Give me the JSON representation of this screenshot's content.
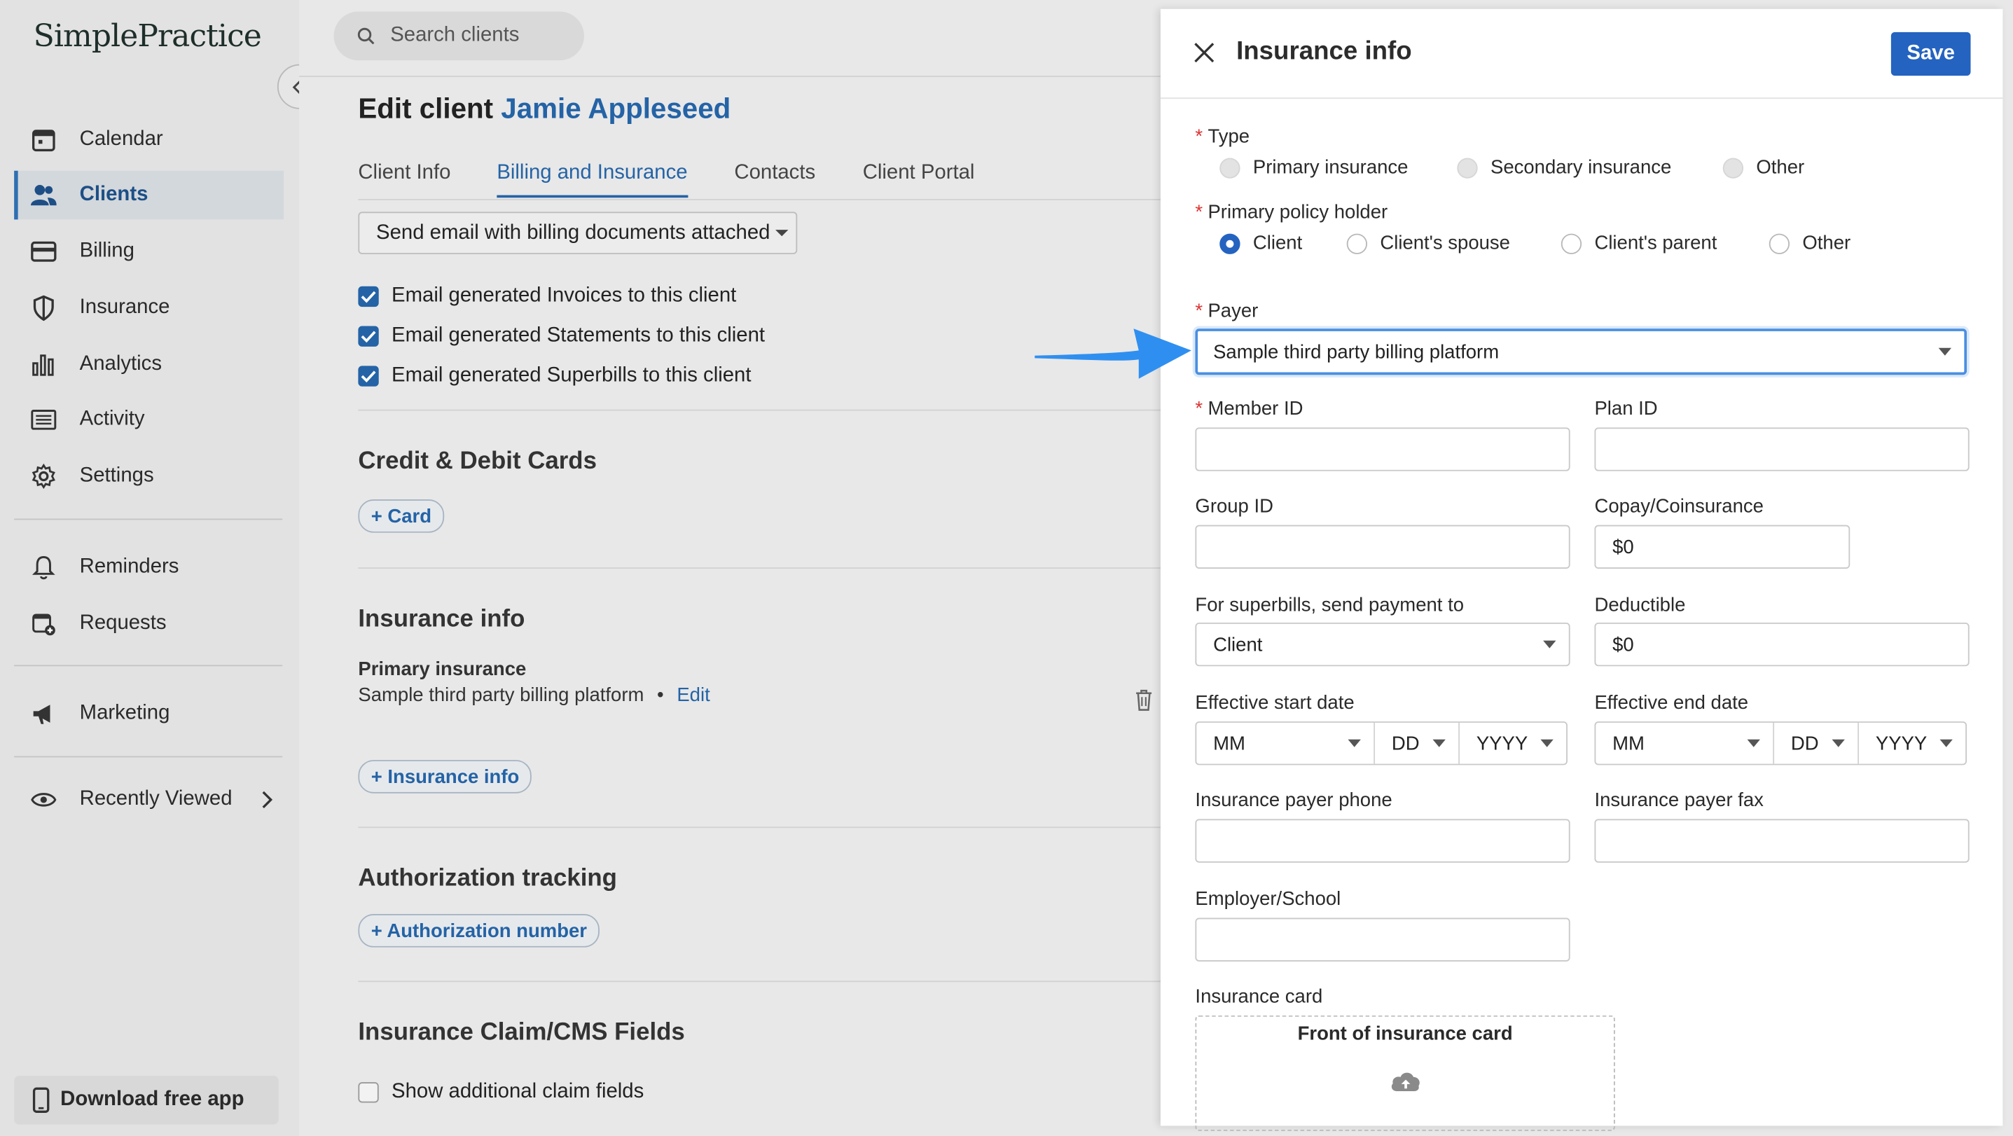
{
  "sidebar": {
    "logo": "SimplePractice",
    "items": [
      {
        "label": "Calendar",
        "icon": "calendar-icon"
      },
      {
        "label": "Clients",
        "icon": "clients-icon"
      },
      {
        "label": "Billing",
        "icon": "credit-card-icon"
      },
      {
        "label": "Insurance",
        "icon": "shield-icon"
      },
      {
        "label": "Analytics",
        "icon": "bar-chart-icon"
      },
      {
        "label": "Activity",
        "icon": "list-icon"
      },
      {
        "label": "Settings",
        "icon": "gear-icon"
      },
      {
        "label": "Reminders",
        "icon": "bell-icon"
      },
      {
        "label": "Requests",
        "icon": "calendar-plus-icon"
      },
      {
        "label": "Marketing",
        "icon": "megaphone-icon"
      },
      {
        "label": "Recently Viewed",
        "icon": "eye-icon"
      }
    ],
    "download": "Download free app"
  },
  "main": {
    "search_placeholder": "Search clients",
    "title_prefix": "Edit client",
    "client_name": "Jamie Appleseed",
    "tabs": [
      "Client Info",
      "Billing and Insurance",
      "Contacts",
      "Client Portal"
    ],
    "email_option": "Send email with billing documents attached",
    "checks": [
      "Email generated Invoices to this client",
      "Email generated Statements to this client",
      "Email generated Superbills to this client"
    ],
    "cards_heading": "Credit & Debit Cards",
    "add_card": "+ Card",
    "insurance_heading": "Insurance info",
    "primary_label": "Primary insurance",
    "primary_payer": "Sample third party billing platform",
    "bullet": "•",
    "edit": "Edit",
    "add_insurance": "+ Insurance info",
    "auth_heading": "Authorization tracking",
    "add_auth": "+ Authorization number",
    "claim_heading": "Insurance Claim/CMS Fields",
    "claim_check": "Show additional claim fields"
  },
  "drawer": {
    "title": "Insurance info",
    "save": "Save",
    "required_mark": "*",
    "type_label": "Type",
    "type_options": [
      "Primary insurance",
      "Secondary insurance",
      "Other"
    ],
    "holder_label": "Primary policy holder",
    "holder_options": [
      "Client",
      "Client's spouse",
      "Client's parent",
      "Other"
    ],
    "payer_label": "Payer",
    "payer_value": "Sample third party billing platform",
    "member_id_label": "Member ID",
    "plan_id_label": "Plan ID",
    "group_id_label": "Group ID",
    "copay_label": "Copay/Coinsurance",
    "copay_value": "$0",
    "superbill_label": "For superbills, send payment to",
    "superbill_value": "Client",
    "deductible_label": "Deductible",
    "deductible_value": "$0",
    "start_label": "Effective start date",
    "end_label": "Effective end date",
    "date_mm": "MM",
    "date_dd": "DD",
    "date_yyyy": "YYYY",
    "phone_label": "Insurance payer phone",
    "fax_label": "Insurance payer fax",
    "employer_label": "Employer/School",
    "card_label": "Insurance card",
    "front_card": "Front of insurance card"
  },
  "colors": {
    "accent": "#2463a6",
    "button": "#2463c0",
    "arrow": "#2f8ff0"
  }
}
